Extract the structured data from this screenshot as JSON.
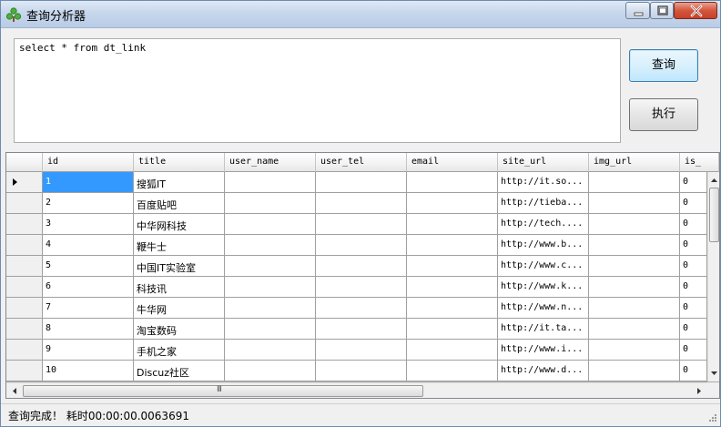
{
  "window": {
    "title": "查询分析器"
  },
  "query": {
    "text": "select * from dt_link"
  },
  "buttons": {
    "query_label": "查询",
    "execute_label": "执行"
  },
  "grid": {
    "columns": [
      "id",
      "title",
      "user_name",
      "user_tel",
      "email",
      "site_url",
      "img_url",
      "is_"
    ],
    "rows": [
      {
        "id": "1",
        "title": "搜狐IT",
        "site_url": "http://it.so...",
        "is_": "0"
      },
      {
        "id": "2",
        "title": "百度贴吧",
        "site_url": "http://tieba...",
        "is_": "0"
      },
      {
        "id": "3",
        "title": "中华网科技",
        "site_url": "http://tech....",
        "is_": "0"
      },
      {
        "id": "4",
        "title": "鞭牛士",
        "site_url": "http://www.b...",
        "is_": "0"
      },
      {
        "id": "5",
        "title": "中国IT实验室",
        "site_url": "http://www.c...",
        "is_": "0"
      },
      {
        "id": "6",
        "title": "科技讯",
        "site_url": "http://www.k...",
        "is_": "0"
      },
      {
        "id": "7",
        "title": "牛华网",
        "site_url": "http://www.n...",
        "is_": "0"
      },
      {
        "id": "8",
        "title": "淘宝数码",
        "site_url": "http://it.ta...",
        "is_": "0"
      },
      {
        "id": "9",
        "title": "手机之家",
        "site_url": "http://www.i...",
        "is_": "0"
      },
      {
        "id": "10",
        "title": "Discuz社区",
        "site_url": "http://www.d...",
        "is_": "0"
      }
    ],
    "selected_row": 0,
    "hscroll_thumb_glyph": "III"
  },
  "status": {
    "text": "查询完成！ 耗时00:00:00.0063691"
  }
}
